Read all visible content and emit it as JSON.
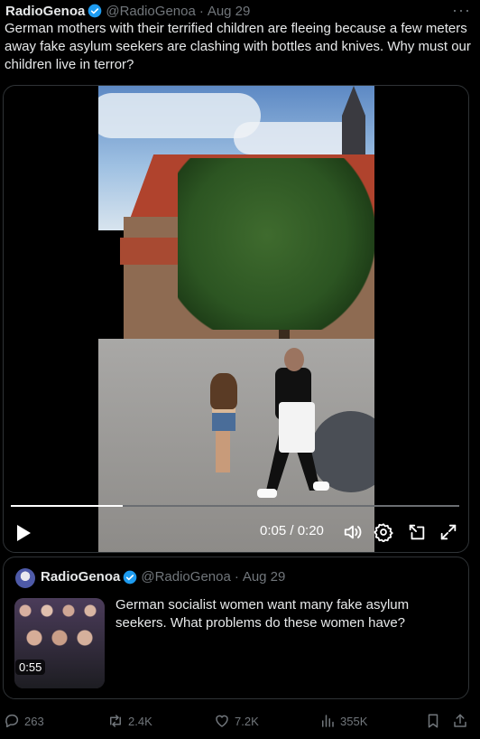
{
  "post": {
    "display_name": "RadioGenoa",
    "handle": "@RadioGenoa",
    "separator": "·",
    "date": "Aug 29",
    "more_label": "···",
    "text": "German mothers with their terrified children are fleeing because a few meters away fake asylum seekers are clashing with bottles and knives. Why must our children live in terror?"
  },
  "video": {
    "time": "0:05 / 0:20",
    "progress_fraction": 0.25
  },
  "quoted": {
    "display_name": "RadioGenoa",
    "handle": "@RadioGenoa",
    "separator": "·",
    "date": "Aug 29",
    "text": "German socialist women want many fake asylum seekers. What problems do these women have?",
    "duration": "0:55"
  },
  "actions": {
    "replies": "263",
    "reposts": "2.4K",
    "likes": "7.2K",
    "views": "355K"
  },
  "colors": {
    "background": "#000000",
    "text": "#e7e9ea",
    "muted": "#71767b",
    "verified": "#1d9bf0",
    "border": "#2f3336"
  }
}
